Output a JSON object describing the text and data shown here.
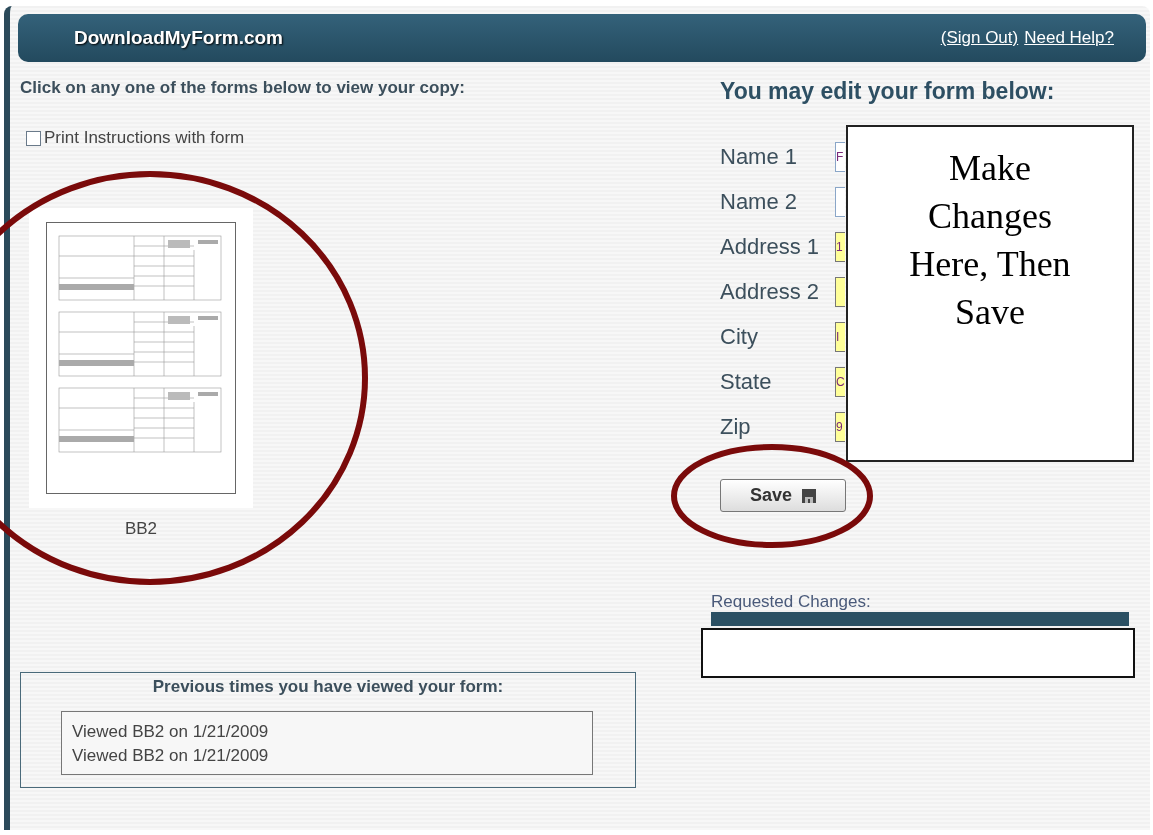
{
  "header": {
    "site_name": "DownloadMyForm.com",
    "links": [
      "(Sign Out)",
      "Need Help?"
    ]
  },
  "left": {
    "instruction": "Click on any one of the forms below to view your copy:",
    "print_option": {
      "label": "Print Instructions with form",
      "checked": false
    },
    "forms": [
      {
        "caption": "BB2"
      }
    ],
    "history": {
      "title": "Previous times you have viewed your form:",
      "entries": [
        "Viewed BB2 on 1/21/2009",
        "Viewed BB2 on 1/21/2009"
      ]
    }
  },
  "right": {
    "title": "You may edit your form below:",
    "fields": [
      {
        "label": "Name 1",
        "value": "F",
        "highlighted": false
      },
      {
        "label": "Name 2",
        "highlighted": false
      },
      {
        "label": "Address 1",
        "value": "1",
        "highlighted": true
      },
      {
        "label": "Address 2",
        "highlighted": true
      },
      {
        "label": "City",
        "value": "I",
        "highlighted": true
      },
      {
        "label": "State",
        "value": "C",
        "highlighted": true
      },
      {
        "label": "Zip",
        "value": "9",
        "highlighted": true
      }
    ],
    "save_button": "Save",
    "requested_changes_label": "Requested Changes:"
  },
  "callout": {
    "text": "Make Changes Here, Then Save"
  }
}
